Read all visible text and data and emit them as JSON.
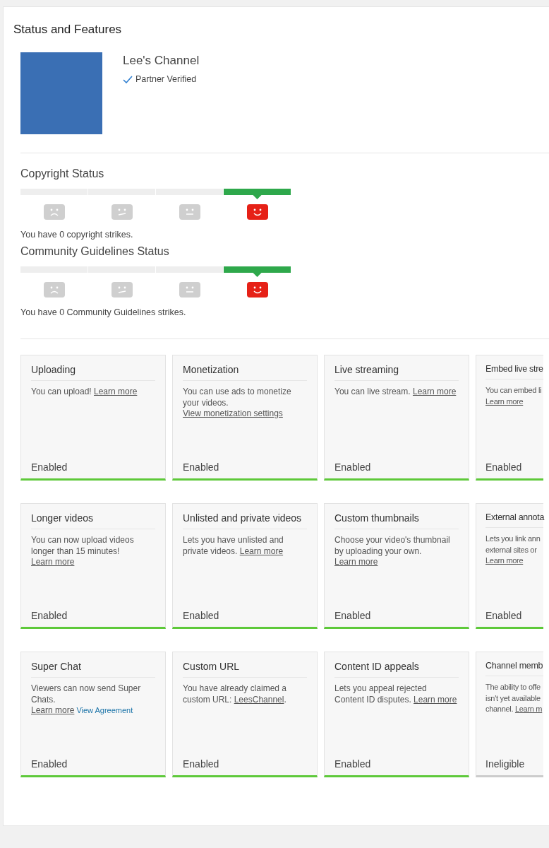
{
  "title": "Status and Features",
  "channel": {
    "name": "Lee's Channel",
    "verified": true,
    "badge": "Partner Verified"
  },
  "statuses": [
    {
      "title": "Copyright Status",
      "meter": [
        {
          "kind": "sad",
          "selected": false
        },
        {
          "kind": "skeptical",
          "selected": false
        },
        {
          "kind": "neutral",
          "selected": false
        },
        {
          "kind": "happy",
          "selected": true
        }
      ],
      "message": "You have 0 copyright strikes."
    },
    {
      "title": "Community Guidelines Status",
      "meter": [
        {
          "kind": "sad",
          "selected": false
        },
        {
          "kind": "skeptical",
          "selected": false
        },
        {
          "kind": "neutral",
          "selected": false
        },
        {
          "kind": "happy",
          "selected": true
        }
      ],
      "message": "You have 0 Community Guidelines strikes."
    }
  ],
  "features": [
    {
      "title": "Uploading",
      "text": [
        {
          "kind": "text",
          "text": "You can upload! "
        },
        {
          "kind": "link",
          "text": "Learn more"
        }
      ],
      "status": "Enabled",
      "enabled": true
    },
    {
      "title": "Monetization",
      "text": [
        {
          "kind": "text",
          "text": "You can use ads to monetize your videos. "
        },
        {
          "kind": "link",
          "text": "View monetization settings"
        }
      ],
      "status": "Enabled",
      "enabled": true
    },
    {
      "title": "Live streaming",
      "text": [
        {
          "kind": "text",
          "text": "You can live stream. "
        },
        {
          "kind": "link",
          "text": "Learn more"
        }
      ],
      "status": "Enabled",
      "enabled": true
    },
    {
      "title": "Embed live stre",
      "lines": [
        [
          {
            "kind": "text",
            "text": "You can embed li"
          }
        ],
        [
          {
            "kind": "link",
            "text": "Learn more"
          }
        ]
      ],
      "status": "Enabled",
      "enabled": true
    },
    {
      "title": "Longer videos",
      "text": [
        {
          "kind": "text",
          "text": "You can now upload videos longer than 15 minutes! "
        },
        {
          "kind": "link",
          "text": "Learn more"
        }
      ],
      "status": "Enabled",
      "enabled": true
    },
    {
      "title": "Unlisted and private videos",
      "text": [
        {
          "kind": "text",
          "text": "Lets you have unlisted and private videos. "
        },
        {
          "kind": "link",
          "text": "Learn more"
        }
      ],
      "status": "Enabled",
      "enabled": true
    },
    {
      "title": "Custom thumbnails",
      "text": [
        {
          "kind": "text",
          "text": "Choose your video's thumbnail by uploading your own. "
        },
        {
          "kind": "link",
          "text": "Learn more"
        }
      ],
      "status": "Enabled",
      "enabled": true
    },
    {
      "title": "External annota",
      "lines": [
        [
          {
            "kind": "text",
            "text": "Lets you link ann"
          }
        ],
        [
          {
            "kind": "text",
            "text": "external sites or"
          }
        ],
        [
          {
            "kind": "link",
            "text": "Learn more"
          }
        ]
      ],
      "status": "Enabled",
      "enabled": true
    },
    {
      "title": "Super Chat",
      "text": [
        {
          "kind": "text",
          "text": "Viewers can now send Super Chats. "
        },
        {
          "kind": "link",
          "text": "Learn more"
        },
        {
          "kind": "action",
          "text": "View Agreement"
        }
      ],
      "status": "Enabled",
      "enabled": true
    },
    {
      "title": "Custom URL",
      "text": [
        {
          "kind": "text",
          "text": "You have already claimed a custom URL: "
        },
        {
          "kind": "link",
          "text": "LeesChannel"
        },
        {
          "kind": "text",
          "text": "."
        }
      ],
      "status": "Enabled",
      "enabled": true
    },
    {
      "title": "Content ID appeals",
      "text": [
        {
          "kind": "text",
          "text": "Lets you appeal rejected Content ID disputes. "
        },
        {
          "kind": "link",
          "text": "Learn more"
        }
      ],
      "status": "Enabled",
      "enabled": true
    },
    {
      "title": "Channel memb",
      "lines": [
        [
          {
            "kind": "text",
            "text": "The ability to offe"
          }
        ],
        [
          {
            "kind": "text",
            "text": "isn't yet available"
          }
        ],
        [
          {
            "kind": "text",
            "text": "channel. "
          },
          {
            "kind": "link",
            "text": "Learn m"
          }
        ]
      ],
      "status": "Ineligible",
      "enabled": false
    }
  ]
}
